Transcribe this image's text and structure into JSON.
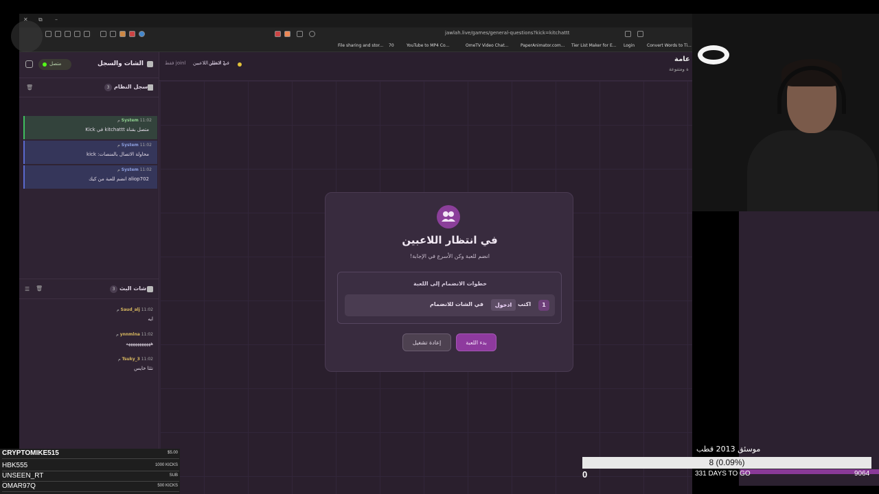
{
  "browser": {
    "url": "jawlah.live/games/general-questions?kick=kitchattt",
    "bookmarks": [
      "File sharing and stor...",
      "70",
      "YouTube to MP4 Co...",
      "OmeTV Video Chat...",
      "PaperAnimator.com...",
      "Tier List Maker for E...",
      "Login",
      "Convert Words to Ti..."
    ]
  },
  "topbar": {
    "players_count": "1 لاعبين",
    "status": "في انتظار اللاعبين",
    "join_hint": "joinl فقط",
    "game_title": "عامة",
    "game_subtitle": "ة ومتنوعة"
  },
  "sidebar": {
    "title": "الشات والسجل",
    "connection": "متصل",
    "syslog_title": "سجل النظام",
    "syslog_count": "3",
    "messages": [
      {
        "user": "System",
        "time": "11:02 م",
        "text": "متصل بقناة kitchattt في Kick"
      },
      {
        "user": "System",
        "time": "11:02 م",
        "text": "محاولة الاتصال بالمنصات: kick"
      },
      {
        "user": "System",
        "time": "11:02 م",
        "text": "aliop702 انضم للعبة من كيك"
      }
    ],
    "stream_chat_title": "شات البث",
    "stream_chat_count": "3",
    "chat": [
      {
        "user": "Saud_alj",
        "time": "11:02 م",
        "text": "ايه"
      },
      {
        "user": "ynnmlna",
        "time": "11:02 م",
        "text": "هههههههههههه"
      },
      {
        "user": "Tsuky_3",
        "time": "11:02 م",
        "text": "نثثا خايس"
      }
    ]
  },
  "card": {
    "title": "في انتظار اللاعبين",
    "subtitle": "انضم للعبة وكن الأسرع في الإجابة!",
    "steps_title": "خطوات الانضمام إلى اللعبة",
    "step_number": "1",
    "step_prefix": "اكتب",
    "step_keyword": "ادخول",
    "step_suffix": "في الشات للانضمام",
    "start_button": "بدء اللعبة",
    "restart_button": "إعادة تشغيل"
  },
  "donors": [
    {
      "name": "CRYPTOMIKE515",
      "amount": "$5.00"
    },
    {
      "name": "HBK555",
      "amount": "1000 KICKS"
    },
    {
      "name": "UNSEEN_RT",
      "amount": "SUB"
    },
    {
      "name": "OMAR97Q",
      "amount": "500 KICKS"
    }
  ],
  "goal": {
    "title": "موسئق 2013 قطب",
    "value": "8 (0.09%)",
    "min": "0",
    "days": "331 DAYS TO GO",
    "max": "9064",
    "progress_fraction": 0.0009
  },
  "colors": {
    "accent": "#8e3a9e",
    "background": "#2c2130",
    "kick_green": "#53fc18"
  }
}
